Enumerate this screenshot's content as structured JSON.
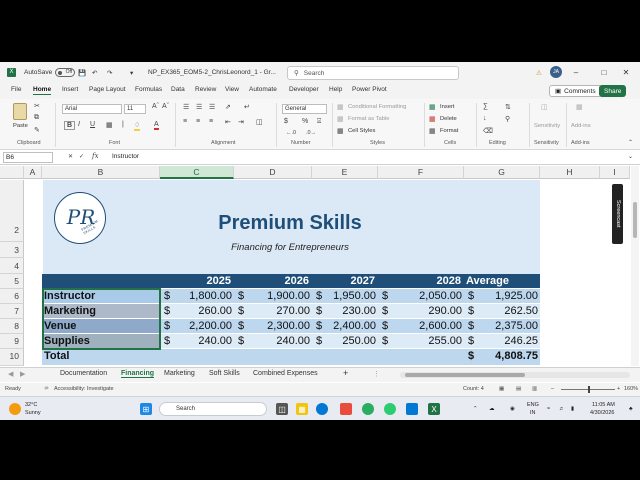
{
  "titlebar": {
    "autosave_label": "AutoSave",
    "autosave_state": "Off",
    "file_name": "NP_EX365_EOM5-2_ChrisLeonord_1  -  Gr...",
    "search_placeholder": "Search",
    "user_initials": "JA"
  },
  "menu": {
    "tabs": [
      "File",
      "Home",
      "Insert",
      "Page Layout",
      "Formulas",
      "Data",
      "Review",
      "View",
      "Automate",
      "Developer",
      "Help",
      "Power Pivot"
    ],
    "comments_label": "Comments",
    "share_label": "Share"
  },
  "ribbon": {
    "paste_label": "Paste",
    "clipboard_label": "Clipboard",
    "font_name": "Arial",
    "font_size": "11",
    "font_label": "Font",
    "alignment_label": "Alignment",
    "number_format": "General",
    "number_label": "Number",
    "conditional_formatting": "Conditional Formatting",
    "format_as_table": "Format as Table",
    "cell_styles": "Cell Styles",
    "styles_label": "Styles",
    "insert_label": "Insert",
    "delete_label": "Delete",
    "format_label": "Format",
    "cells_label": "Cells",
    "editing_label": "Editing",
    "sensitivity_label": "Sensitivity",
    "addins_label": "Add-ins"
  },
  "formula_bar": {
    "name_box": "B6",
    "content": "Instructor"
  },
  "grid": {
    "columns": [
      "A",
      "B",
      "C",
      "D",
      "E",
      "F",
      "G",
      "H",
      "I"
    ],
    "rows": [
      "2",
      "3",
      "4",
      "5",
      "6",
      "7",
      "8",
      "9",
      "10"
    ]
  },
  "sheet": {
    "logo_text": "PR",
    "logo_subtext": "PREMIUM SKILLS",
    "title": "Premium Skills",
    "subtitle": "Financing for Entrepreneurs",
    "year_headers": [
      "2025",
      "2026",
      "2027",
      "2028",
      "Average"
    ],
    "rows": [
      {
        "label": "Instructor",
        "values": [
          "1,800.00",
          "1,900.00",
          "1,950.00",
          "2,050.00",
          "1,925.00"
        ]
      },
      {
        "label": "Marketing",
        "values": [
          "260.00",
          "270.00",
          "230.00",
          "290.00",
          "262.50"
        ]
      },
      {
        "label": "Venue",
        "values": [
          "2,200.00",
          "2,300.00",
          "2,400.00",
          "2,600.00",
          "2,375.00"
        ]
      },
      {
        "label": "Supplies",
        "values": [
          "240.00",
          "240.00",
          "250.00",
          "255.00",
          "246.25"
        ]
      }
    ],
    "total_label": "Total",
    "total_value": "4,808.75",
    "currency": "$",
    "screen_tag": "Screencast"
  },
  "sheet_tabs": [
    "Documentation",
    "Financing",
    "Marketing",
    "Soft Skills",
    "Combined Expenses"
  ],
  "add_sheet": "+",
  "status": {
    "ready": "Ready",
    "accessibility": "Accessibility: Investigate",
    "count": "Count: 4",
    "zoom": "160%"
  },
  "taskbar": {
    "temperature": "32°C",
    "weather": "Sunny",
    "search_placeholder": "Search",
    "lang_top": "ENG",
    "lang_bottom": "IN",
    "time": "11:05 AM",
    "date": "4/30/2026"
  }
}
